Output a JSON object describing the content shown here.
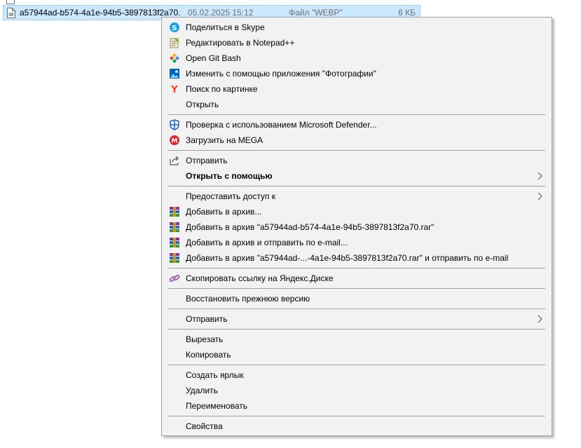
{
  "file_list": {
    "prev_row": {
      "name": "",
      "date": "",
      "type": "",
      "size": ""
    },
    "selected_row": {
      "name": "a57944ad-b574-4a1e-94b5-3897813f2a70....",
      "date": "05.02.2025 15:12",
      "type": "Файл \"WEBP\"",
      "size": "6 КБ"
    }
  },
  "menu": {
    "items": [
      {
        "label": "Поделиться в Skype",
        "icon": "skype-icon"
      },
      {
        "label": "Редактировать в Notepad++",
        "icon": "notepadpp-icon"
      },
      {
        "label": "Open Git Bash",
        "icon": "git-bash-icon"
      },
      {
        "label": "Изменить с помощью приложения \"Фотографии\"",
        "icon": "photos-icon"
      },
      {
        "label": "Поиск по картинке",
        "icon": "yandex-icon"
      },
      {
        "label": "Открыть",
        "icon": ""
      },
      {
        "label": "Проверка с использованием Microsoft Defender...",
        "icon": "defender-icon"
      },
      {
        "label": "Загрузить на MEGA",
        "icon": "mega-icon"
      },
      {
        "label": "Отправить",
        "icon": "share-icon"
      },
      {
        "label": "Открыть с помощью",
        "icon": "",
        "bold": true,
        "submenu": true
      },
      {
        "label": "Предоставить доступ к",
        "icon": "",
        "submenu": true
      },
      {
        "label": "Добавить в архив...",
        "icon": "winrar-icon"
      },
      {
        "label": "Добавить в архив \"a57944ad-b574-4a1e-94b5-3897813f2a70.rar\"",
        "icon": "winrar-icon"
      },
      {
        "label": "Добавить в архив и отправить по e-mail...",
        "icon": "winrar-icon"
      },
      {
        "label": "Добавить в архив \"a57944ad-...-4a1e-94b5-3897813f2a70.rar\" и отправить по e-mail",
        "icon": "winrar-icon"
      },
      {
        "label": "Скопировать ссылку на Яндекс.Диске",
        "icon": "yandex-disk-link-icon"
      },
      {
        "label": "Восстановить прежнюю версию",
        "icon": ""
      },
      {
        "label": "Отправить",
        "icon": "",
        "submenu": true
      },
      {
        "label": "Вырезать",
        "icon": ""
      },
      {
        "label": "Копировать",
        "icon": ""
      },
      {
        "label": "Создать ярлык",
        "icon": ""
      },
      {
        "label": "Удалить",
        "icon": ""
      },
      {
        "label": "Переименовать",
        "icon": ""
      },
      {
        "label": "Свойства",
        "icon": ""
      }
    ]
  }
}
